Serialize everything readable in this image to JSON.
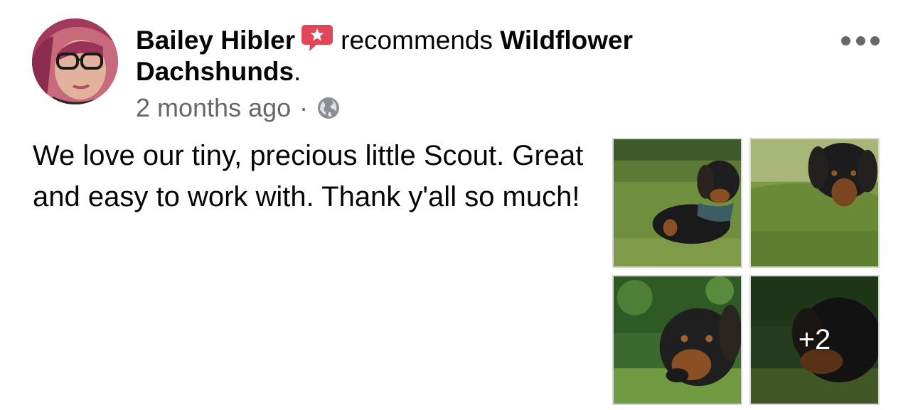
{
  "post": {
    "author_name": "Bailey Hibler",
    "verb": "recommends",
    "page_name": "Wildflower Dachshunds",
    "period": ".",
    "time_ago": "2 months ago",
    "separator": "·",
    "privacy_icon": "globe-icon",
    "review_text": "We love our tiny, precious little Scout. Great and easy to work with. Thank y'all so much!",
    "more_options_icon": "ellipsis-icon",
    "recommend_icon": "recommend-star-icon",
    "accent_color": "#e0475a"
  },
  "photos": {
    "items": [
      {
        "alt": "dachshund-puppy-photo-1"
      },
      {
        "alt": "dachshund-puppy-photo-2"
      },
      {
        "alt": "dachshund-puppy-photo-3"
      },
      {
        "alt": "dachshund-puppy-photo-4"
      }
    ],
    "extra_count_label": "+2"
  }
}
